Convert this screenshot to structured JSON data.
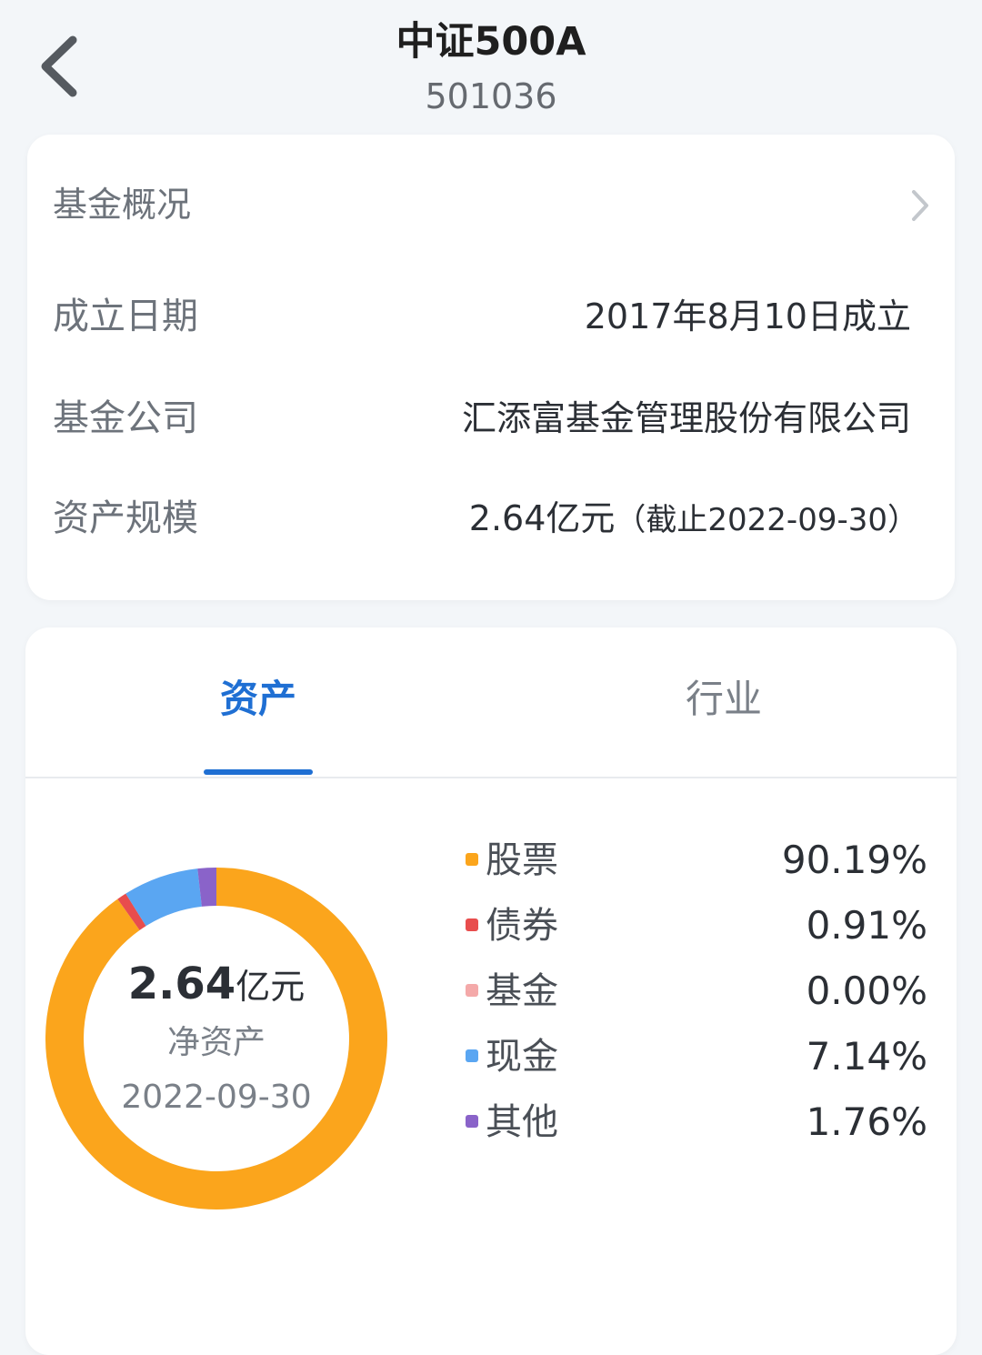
{
  "header": {
    "title": "中证500A",
    "code": "501036"
  },
  "overview": {
    "section_title": "基金概况",
    "rows": [
      {
        "label": "成立日期",
        "value": "2017年8月10日成立"
      },
      {
        "label": "基金公司",
        "value": "汇添富基金管理股份有限公司"
      },
      {
        "label": "资产规模",
        "value": "2.64亿元",
        "value_note": "（截止2022-09-30）"
      }
    ]
  },
  "tabs": {
    "assets": "资产",
    "industry": "行业",
    "active": "资产"
  },
  "summary": {
    "amount": "2.64",
    "unit": "亿元",
    "label": "净资产",
    "date": "2022-09-30"
  },
  "chart_data": {
    "type": "pie",
    "title": "",
    "categories": [
      "股票",
      "债券",
      "基金",
      "现金",
      "其他"
    ],
    "values": [
      90.19,
      0.91,
      0.0,
      7.14,
      1.76
    ],
    "value_labels": [
      "90.19%",
      "0.91%",
      "0.00%",
      "7.14%",
      "1.76%"
    ],
    "colors": [
      "#fba51c",
      "#e84d4d",
      "#f4a9a9",
      "#5aa6f2",
      "#8a63c9"
    ],
    "style": "donut",
    "legend_placement": "right"
  },
  "icons": {
    "back": "chevron-left-icon",
    "overview_more": "chevron-right-icon"
  }
}
